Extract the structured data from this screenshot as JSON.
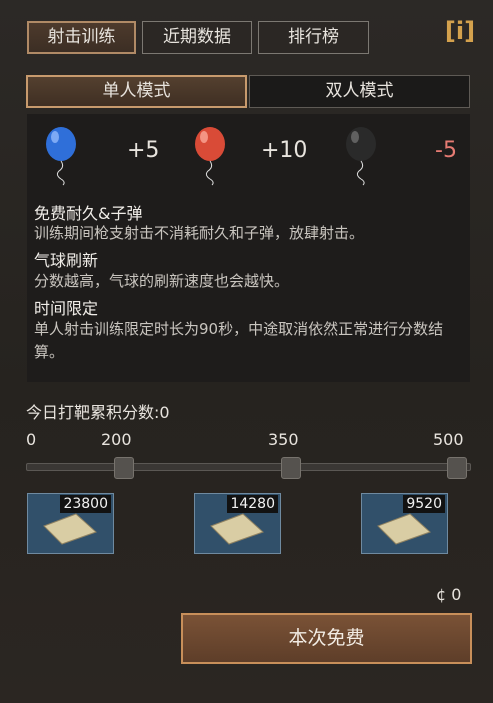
{
  "tabs": [
    {
      "label": "射击训练"
    },
    {
      "label": "近期数据"
    },
    {
      "label": "排行榜"
    }
  ],
  "info_icon": "[i]",
  "modes": [
    {
      "label": "单人模式"
    },
    {
      "label": "双人模式"
    }
  ],
  "balloons": [
    {
      "color": "#2f6fd9",
      "score": "+5"
    },
    {
      "color": "#d94b37",
      "score": "+10"
    },
    {
      "color": "#2a2a2a",
      "score": "-5"
    }
  ],
  "rules": [
    {
      "title": "免费耐久&子弹",
      "text": "训练期间枪支射击不消耗耐久和子弹，放肆射击。"
    },
    {
      "title": "气球刷新",
      "text": "分数越高，气球的刷新速度也会越快。"
    },
    {
      "title": "时间限定",
      "text": "单人射击训练限定时长为90秒，中途取消依然正常进行分数结算。"
    }
  ],
  "today_label": "今日打靶累积分数:",
  "today_value": "0",
  "ticks": [
    "0",
    "200",
    "350",
    "500"
  ],
  "progress": 0,
  "rewards": [
    {
      "count": "23800"
    },
    {
      "count": "14280"
    },
    {
      "count": "9520"
    }
  ],
  "currency_value": "0",
  "free_button": "本次免费"
}
